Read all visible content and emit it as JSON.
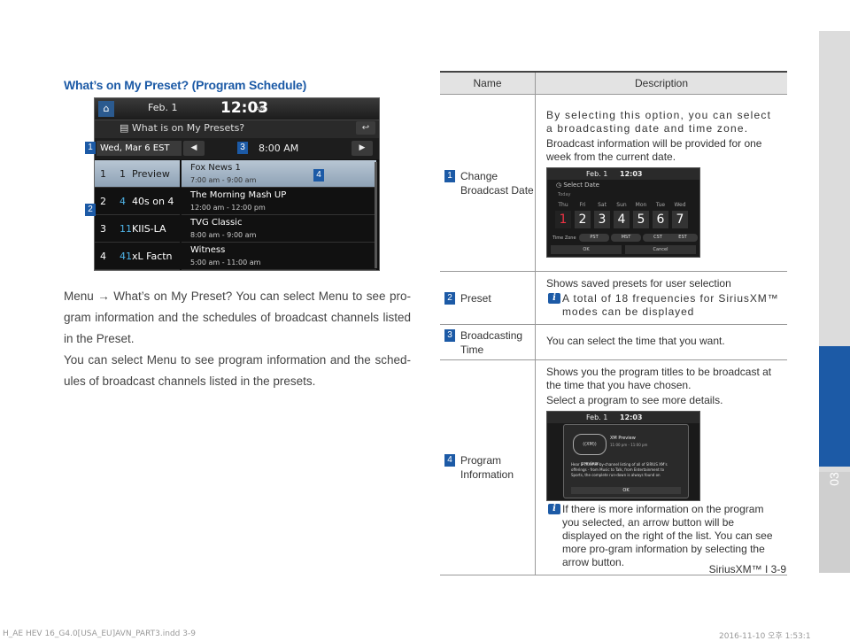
{
  "section_title": "What’s on My Preset? (Program Schedule)",
  "screen": {
    "home_icon": "home-icon",
    "date": "Feb.  1",
    "time": "12:03",
    "ampm": "AM",
    "title": "What is on My Presets?",
    "back_icon": "back-arrow-icon",
    "day": "Wed, Mar 6 EST",
    "prev_arrow": "◀",
    "next_arrow": "▶",
    "broadcast_time": "8:00 AM",
    "presets": [
      {
        "n": "1",
        "ch": "1",
        "name": "Preview"
      },
      {
        "n": "2",
        "ch": "4",
        "name": "40s on 4"
      },
      {
        "n": "3",
        "ch": "11",
        "name": "KIIS-LA"
      },
      {
        "n": "4",
        "ch": "41",
        "name": "xL Factn"
      }
    ],
    "programs": [
      {
        "title": "Fox News 1",
        "hours": "7:00 am - 9:00 am"
      },
      {
        "title": "The Morning Mash UP",
        "hours": "12:00 am - 12:00 pm"
      },
      {
        "title": "TVG Classic",
        "hours": "8:00 am - 9:00 am"
      },
      {
        "title": "Witness",
        "hours": "5:00 am - 11:00 am"
      }
    ]
  },
  "badges": [
    "1",
    "2",
    "3",
    "4"
  ],
  "body": {
    "p1": "Menu → What’s on My Preset? You can select Menu to see pro-gram information and the schedules of broadcast channels listed in the Preset.",
    "p2": "You can select Menu to see program information and the sched-ules of broadcast channels listed in the presets."
  },
  "table": {
    "headers": [
      "Name",
      "Description"
    ],
    "rows": [
      {
        "badge": "1",
        "name": "Change Broadcast Date",
        "desc": [
          "By selecting this option, you can select a broadcasting date and time zone.",
          "Broadcast information will be provided for one week from the current date."
        ],
        "note": ""
      },
      {
        "badge": "2",
        "name": "Preset",
        "desc": [
          "Shows saved presets for user selection"
        ],
        "note": "A total of 18 frequencies for SiriusXM™ modes can be displayed"
      },
      {
        "badge": "3",
        "name": "Broadcasting Time",
        "desc": [
          "You can select the time that you want."
        ],
        "note": ""
      },
      {
        "badge": "4",
        "name": "Program Information",
        "desc": [
          "Shows you the program titles to be broadcast at the time that you have chosen.",
          "Select a program to see more details."
        ],
        "note": "If there is more information on the program you selected, an arrow button will be displayed on the right of the list. You can see more pro-gram information by selecting the arrow button."
      }
    ]
  },
  "mini_date": {
    "date": "Feb.  1",
    "time": "12:03",
    "title": "Select Date",
    "today": "Today",
    "days": [
      "Thu",
      "Fri",
      "Sat",
      "Sun",
      "Mon",
      "Tue",
      "Wed"
    ],
    "nums": [
      "1",
      "2",
      "3",
      "4",
      "5",
      "6",
      "7"
    ],
    "zone_label": "Time Zone",
    "zones": [
      "PST",
      "MST",
      "CST",
      "EST"
    ],
    "ok": "OK",
    "cancel": "Cancel"
  },
  "mini_prog": {
    "date": "Feb.  1",
    "time": "12:03",
    "logo": "((XM)) preview",
    "channel": "XM Preview",
    "hours": "11:00 pm - 11:00 pm",
    "text": "Hear a channel-by-channel listing of all of SIRIUS XM's offerings - from Music to Talk, from Entertainment to Sports, the complete run-down is always found on",
    "ok": "OK"
  },
  "tab_number": "03",
  "footer": "SiriusXM™ I 3-9",
  "slug_left": "H_AE HEV 16_G4.0[USA_EU]AVN_PART3.indd   3-9",
  "slug_right": "2016-11-10   오후 1:53:1"
}
